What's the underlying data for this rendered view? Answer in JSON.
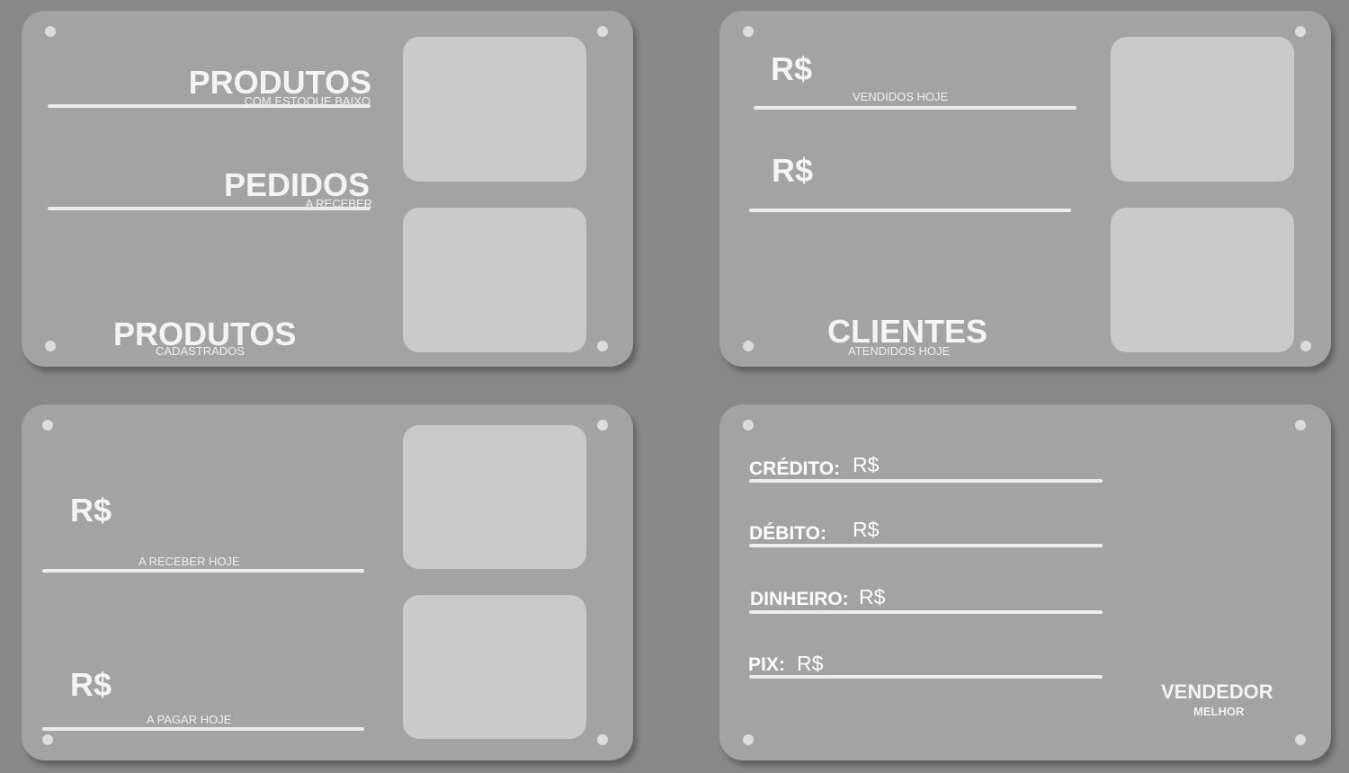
{
  "panel_products": {
    "low_stock_title": "PRODUTOS",
    "low_stock_sub": "COM ESTOQUE BAIXO",
    "orders_title": "PEDIDOS",
    "orders_sub": "A RECEBER",
    "registered_title": "PRODUTOS",
    "registered_sub": "CADASTRADOS"
  },
  "panel_sales": {
    "sold_currency": "R$",
    "sold_sub": "VENDIDOS HOJE",
    "second_currency": "R$",
    "clients_title": "CLIENTES",
    "clients_sub": "ATENDIDOS HOJE"
  },
  "panel_finance": {
    "receive_currency": "R$",
    "receive_sub": "A RECEBER HOJE",
    "pay_currency": "R$",
    "pay_sub": "A PAGAR HOJE"
  },
  "panel_payments": {
    "methods": [
      {
        "label": "CRÉDITO:",
        "currency": "R$"
      },
      {
        "label": "DÉBITO:",
        "currency": "R$"
      },
      {
        "label": "DINHEIRO:",
        "currency": "R$"
      },
      {
        "label": "PIX:",
        "currency": "R$"
      }
    ],
    "seller_title": "VENDEDOR",
    "seller_sub": "MELHOR"
  },
  "colors": {
    "background": "#888888",
    "panel": "#a3a3a3",
    "box": "#cacaca",
    "text": "#ffffff"
  }
}
